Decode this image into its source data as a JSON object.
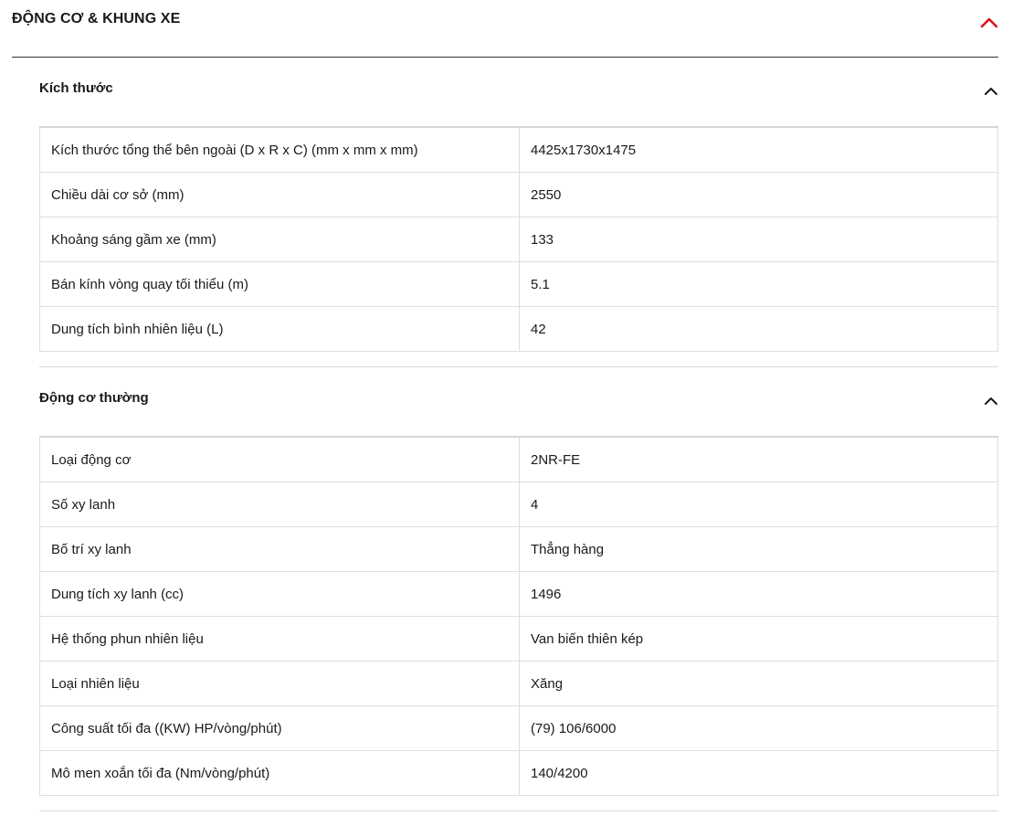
{
  "main_section": {
    "title": "ĐỘNG CƠ & KHUNG XE",
    "accent_color": "#e0111b",
    "chevron_icon": "chevron-up-icon"
  },
  "dimensions": {
    "title": "Kích thước",
    "chevron_icon": "chevron-up-icon",
    "rows": [
      {
        "label": "Kích thước tổng thể bên ngoài (D x R x C) (mm x mm x mm)",
        "value": "4425x1730x1475"
      },
      {
        "label": "Chiều dài cơ sở (mm)",
        "value": "2550"
      },
      {
        "label": "Khoảng sáng gầm xe (mm)",
        "value": "133"
      },
      {
        "label": "Bán kính vòng quay tối thiểu (m)",
        "value": "5.1"
      },
      {
        "label": "Dung tích bình nhiên liệu (L)",
        "value": "42"
      }
    ]
  },
  "engine": {
    "title": "Động cơ thường",
    "chevron_icon": "chevron-up-icon",
    "rows": [
      {
        "label": "Loại động cơ",
        "value": "2NR-FE"
      },
      {
        "label": "Số xy lanh",
        "value": "4"
      },
      {
        "label": "Bố trí xy lanh",
        "value": "Thẳng hàng"
      },
      {
        "label": "Dung tích xy lanh (cc)",
        "value": "1496"
      },
      {
        "label": "Hệ thống phun nhiên liệu",
        "value": "Van biến thiên kép"
      },
      {
        "label": "Loại nhiên liệu",
        "value": "Xăng"
      },
      {
        "label": "Công suất tối đa ((KW) HP/vòng/phút)",
        "value": "(79) 106/6000"
      },
      {
        "label": "Mô men xoắn tối đa (Nm/vòng/phút)",
        "value": "140/4200"
      }
    ]
  }
}
